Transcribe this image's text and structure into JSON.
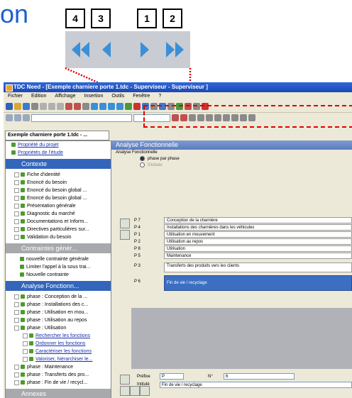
{
  "heading": "on",
  "callouts": [
    "4",
    "3",
    "1",
    "2"
  ],
  "nav_icons": [
    "first-record-icon",
    "previous-record-icon",
    "next-record-icon",
    "last-record-icon"
  ],
  "accent_color": "#1e5fd0",
  "window": {
    "title": "TDC Need - [Exemple charniere porte 1.tdc - Superviseur - Superviseur ]",
    "menu": [
      "Fichier",
      "Edition",
      "Affichage",
      "Insertion",
      "Outils",
      "Fenêtre",
      "?"
    ],
    "doc_tab": "Exemple charniere porte 1.tdc - ..."
  },
  "tree": {
    "top_links": [
      "Propriété du projet",
      "Propriétés de l'étude"
    ],
    "contexte": {
      "title": "Contexte",
      "items": [
        "Fiche d'identité",
        "Enoncé du besoin",
        "Enoncé du besoin global ...",
        "Enoncé du besoin global ...",
        "Présentation générale",
        "Diagnostic du marché",
        "Documentations et Inform...",
        "Directives particulières sur...",
        "Validation du besoin"
      ]
    },
    "contraintes": {
      "title": "Contraintes génér...",
      "items": [
        "nouvelle contrainte générale",
        "Limiter l'appel à la sous trai...",
        "Nouvelle contrainte"
      ]
    },
    "analyse": {
      "title": "Analyse Fonctionn...",
      "items": [
        "phase : Conception de la ...",
        "phase : Installations des c...",
        "phase : Utilisation en mou...",
        "phase : Utilisation au repos",
        "phase : Utilisation"
      ],
      "sub_items": [
        "Rechercher les fonctions",
        "Ordonner les fonctions",
        "Caractériser les fonctions",
        "Valoriser, hiérarchiser le..."
      ],
      "tail_items": [
        "phase : Maintenance",
        "phase : Transferts des pro...",
        "phase : Fin de vie / recycl..."
      ]
    },
    "annexes": {
      "title": "Annexes"
    }
  },
  "main": {
    "title": "Analyse Fonctionnelle",
    "subtitle": "Analyse Fonctionnelle",
    "radio_options": [
      {
        "label": "phase par phase",
        "selected": true
      },
      {
        "label": "Globale",
        "selected": false
      }
    ],
    "rows": [
      {
        "code": "P 7",
        "text": "Conception de la charnière"
      },
      {
        "code": "P 4",
        "text": "Installations des charnières dans les véhicules"
      },
      {
        "code": "P 1",
        "text": "Utilisation en mouvement"
      },
      {
        "code": "P 2",
        "text": "Utilisation au repos"
      },
      {
        "code": "P 8",
        "text": "Utilisation"
      },
      {
        "code": "P 5",
        "text": "Maintenance"
      },
      {
        "code": "P 3",
        "text": "Transferts des produits vers les clients"
      },
      {
        "code": "P 6",
        "text": "Fin de vie / recyclage"
      }
    ],
    "selected_row": 7,
    "prefix_label": "Préfixe",
    "prefix_value": "P",
    "number_label": "N°",
    "number_value": "6",
    "title_label": "Intitulé",
    "title_value": "Fin de vie / recyclage"
  }
}
